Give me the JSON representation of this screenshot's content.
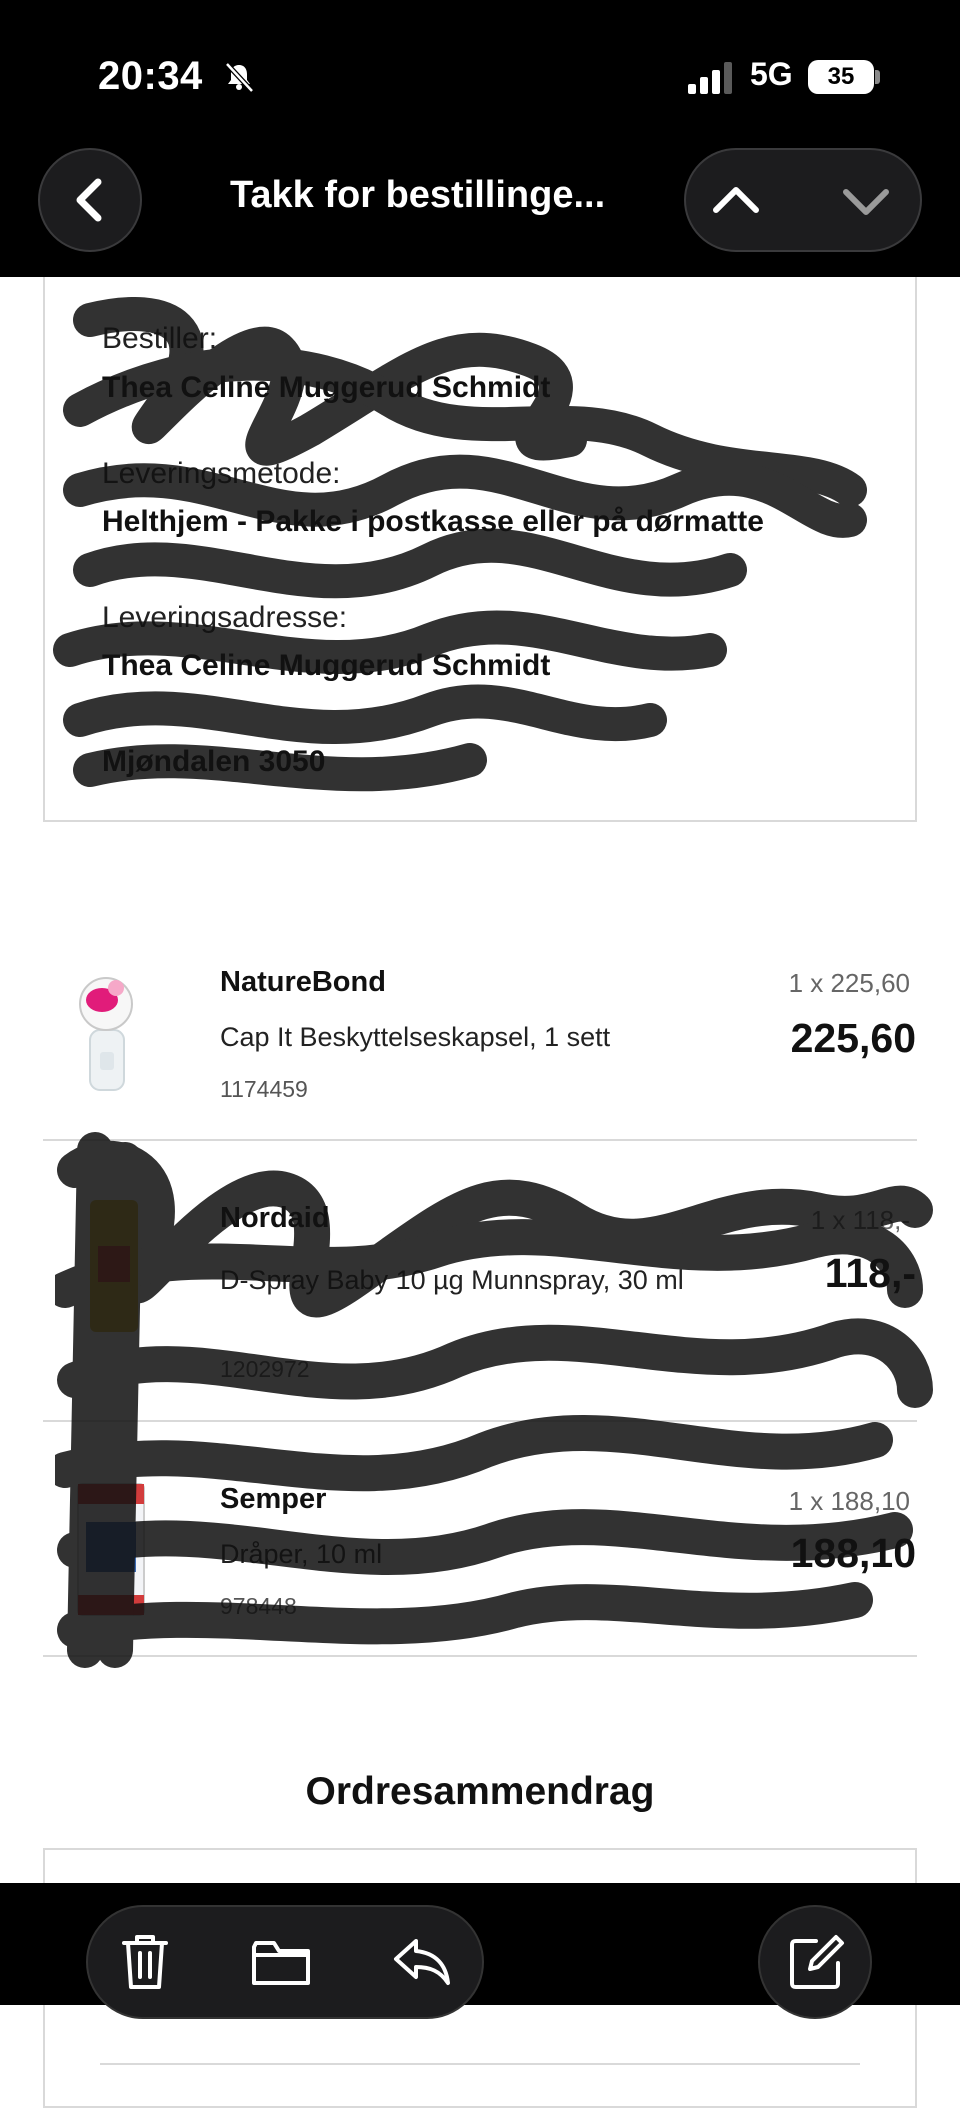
{
  "status_bar": {
    "time": "20:34",
    "network": "5G",
    "battery": "35"
  },
  "nav": {
    "title": "Takk for bestillinge..."
  },
  "order_info": {
    "orderer_label": "Bestiller:",
    "orderer_value": "Thea Celine Muggerud Schmidt",
    "delivery_method_label": "Leveringsmetode:",
    "delivery_method_value": "Helthjem - Pakke i postkasse eller på dørmatte",
    "delivery_address_label": "Leveringsadresse:",
    "delivery_address_name": "Thea Celine Muggerud Schmidt",
    "delivery_address_postal": "Mjøndalen 3050"
  },
  "items": [
    {
      "brand": "NatureBond",
      "name": "Cap It Beskyttelseskapsel, 1 sett",
      "sku": "1174459",
      "qty": "1 x 225,60",
      "price": "225,60"
    },
    {
      "brand": "Nordaid",
      "name": "D-Spray Baby 10 µg Munnspray, 30 ml",
      "sku": "1202972",
      "qty": "1 x 118,-",
      "price": "118,-"
    },
    {
      "brand": "Semper",
      "name": "Dråper, 10 ml",
      "sku": "978448",
      "qty": "1 x 188,10",
      "price": "188,10"
    }
  ],
  "summary": {
    "title": "Ordresammendrag"
  },
  "icons": {
    "back": "chevron-left-icon",
    "prev": "chevron-up-icon",
    "next": "chevron-down-icon",
    "trash": "trash-icon",
    "folder": "folder-icon",
    "reply": "reply-icon",
    "compose": "compose-icon"
  }
}
